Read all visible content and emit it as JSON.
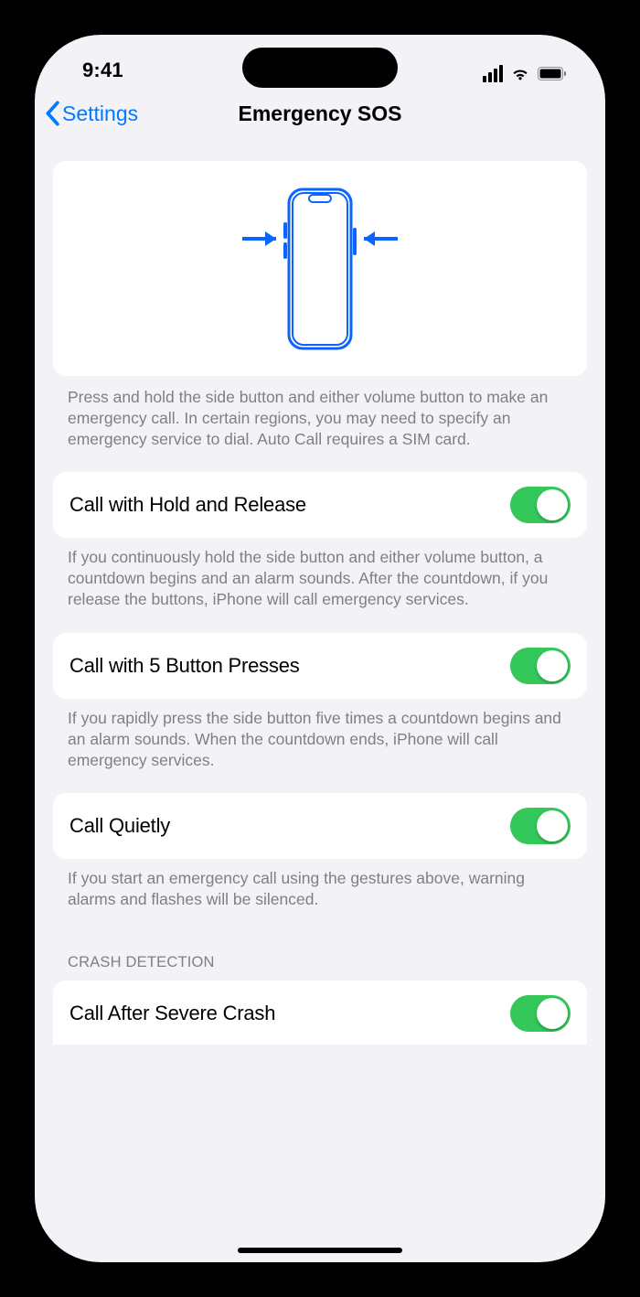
{
  "status": {
    "time": "9:41"
  },
  "nav": {
    "back_label": "Settings",
    "title": "Emergency SOS"
  },
  "hero_footer": "Press and hold the side button and either volume button to make an emergency call. In certain regions, you may need to specify an emergency service to dial. Auto Call requires a SIM card.",
  "options": [
    {
      "label": "Call with Hold and Release",
      "enabled": true,
      "footer": "If you continuously hold the side button and either volume button, a countdown begins and an alarm sounds. After the countdown, if you release the buttons, iPhone will call emergency services."
    },
    {
      "label": "Call with 5 Button Presses",
      "enabled": true,
      "footer": "If you rapidly press the side button five times a countdown begins and an alarm sounds. When the countdown ends, iPhone will call emergency services."
    },
    {
      "label": "Call Quietly",
      "enabled": true,
      "footer": "If you start an emergency call using the gestures above, warning alarms and flashes will be silenced."
    }
  ],
  "crash": {
    "header": "CRASH DETECTION",
    "label": "Call After Severe Crash",
    "enabled": true
  },
  "colors": {
    "accent": "#007aff",
    "toggle_on": "#34c759",
    "bg": "#f2f2f7"
  }
}
